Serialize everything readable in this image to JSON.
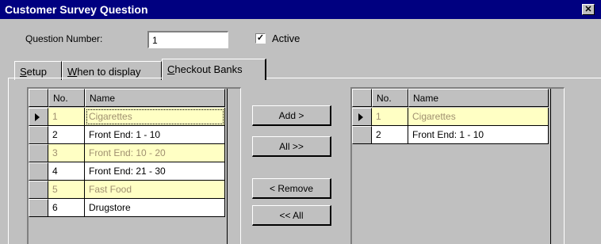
{
  "window": {
    "title": "Customer Survey Question",
    "close_glyph": "✕"
  },
  "form": {
    "question_number_label": "Question Number:",
    "question_number_value": "1",
    "active_label": "Active",
    "active_checked": true,
    "check_glyph": "✓"
  },
  "tabs": [
    {
      "label_underline": "S",
      "label_rest": "etup",
      "active": false
    },
    {
      "label_underline": "W",
      "label_rest": "hen to display",
      "active": false
    },
    {
      "label_underline": "C",
      "label_rest": "heckout Banks",
      "active": true
    }
  ],
  "left_grid": {
    "columns": [
      "No.",
      "Name"
    ],
    "rows": [
      {
        "no": "1",
        "name": "Cigarettes",
        "inactive": true,
        "current": true
      },
      {
        "no": "2",
        "name": "Front End: 1 - 10",
        "inactive": false,
        "current": false
      },
      {
        "no": "3",
        "name": "Front End: 10 - 20",
        "inactive": true,
        "current": false
      },
      {
        "no": "4",
        "name": "Front End: 21 - 30",
        "inactive": false,
        "current": false
      },
      {
        "no": "5",
        "name": "Fast Food",
        "inactive": true,
        "current": false
      },
      {
        "no": "6",
        "name": "Drugstore",
        "inactive": false,
        "current": false
      }
    ]
  },
  "right_grid": {
    "columns": [
      "No.",
      "Name"
    ],
    "rows": [
      {
        "no": "1",
        "name": "Cigarettes",
        "inactive": true,
        "current": true
      },
      {
        "no": "2",
        "name": "Front End: 1 - 10",
        "inactive": false,
        "current": false
      }
    ]
  },
  "buttons": {
    "add": "Add >",
    "all_add": "All >>",
    "remove": "< Remove",
    "all_remove": "<< All"
  },
  "colors": {
    "title_bar": "#000080",
    "inactive_row_bg": "#ffffc4",
    "inactive_row_text": "#a09070",
    "window_bg": "#c0c0c0"
  }
}
